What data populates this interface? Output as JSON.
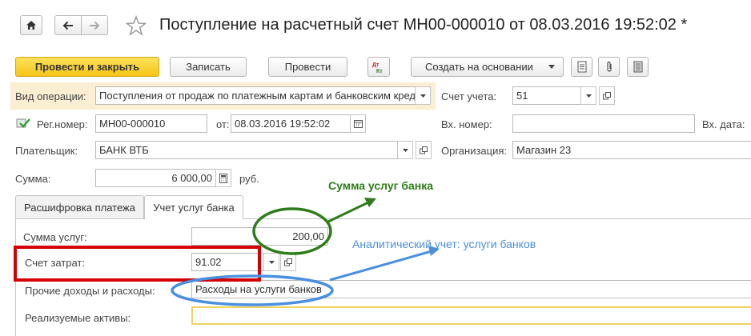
{
  "header": {
    "title": "Поступление на расчетный счет МН00-000010 от 08.03.2016 19:52:02 *"
  },
  "toolbar": {
    "post_close": "Провести и закрыть",
    "save": "Записать",
    "post": "Провести",
    "create_based": "Создать на основании"
  },
  "form": {
    "op_type_label": "Вид операции:",
    "op_type_value": "Поступления от продаж по платежным картам и банковским кред",
    "account_label": "Счет учета:",
    "account_value": "51",
    "reg_label": "Рег.номер:",
    "reg_value": "МН00-000010",
    "from_label": "от:",
    "date_value": "08.03.2016 19:52:02",
    "in_num_label": "Вх. номер:",
    "in_num_value": "",
    "in_date_label": "Вх. дата:",
    "payer_label": "Плательщик:",
    "payer_value": "БАНК ВТБ",
    "org_label": "Организация:",
    "org_value": "Магазин 23",
    "sum_label": "Сумма:",
    "sum_value": "6 000,00",
    "currency": "руб."
  },
  "tabs": [
    {
      "label": "Расшифровка платежа"
    },
    {
      "label": "Учет услуг банка"
    }
  ],
  "services": {
    "sum_label": "Сумма услуг:",
    "sum_value": "200,00",
    "cost_account_label": "Счет затрат:",
    "cost_account_value": "91.02",
    "other_label": "Прочие доходы и расходы:",
    "other_value": "Расходы на услуги банков",
    "assets_label": "Реализуемые активы:",
    "assets_value": ""
  },
  "annotations": {
    "bank_fee": "Сумма услуг банка",
    "analytic": "Аналитический учет: услуги банков"
  },
  "colors": {
    "primary_button": "#f5c518",
    "highlight_row": "#fbeed2",
    "annot_green": "#2e7d1a",
    "annot_blue": "#4a8fe0",
    "annot_red": "#d40000"
  }
}
